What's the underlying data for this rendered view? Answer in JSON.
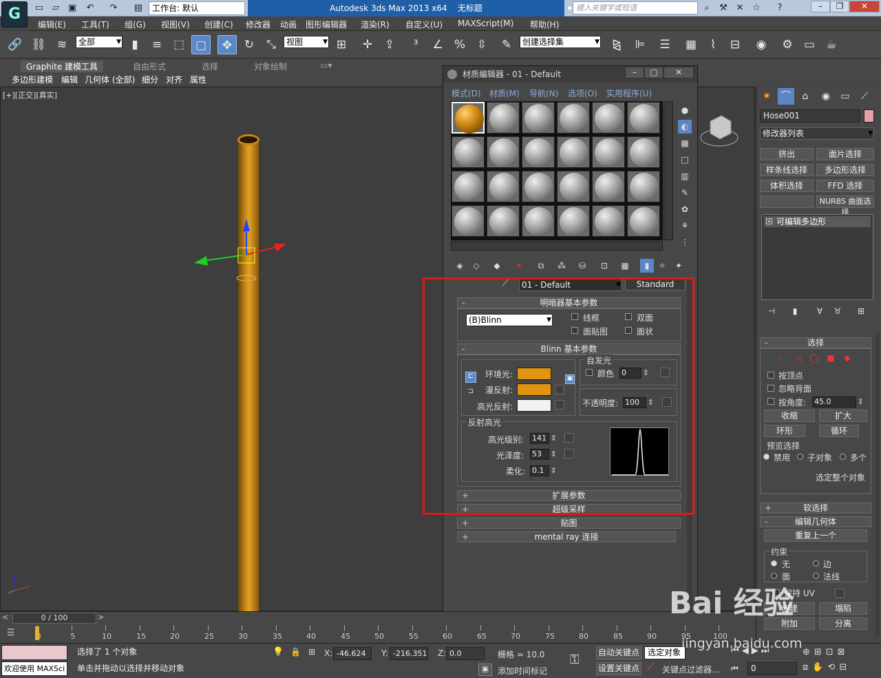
{
  "app": {
    "title": "Autodesk 3ds Max  2013 x64",
    "doc": "无标题",
    "workspace": "工作台: 默认",
    "search_placeholder": "键入关键字或短语",
    "logo": "G"
  },
  "menu": [
    "编辑(E)",
    "工具(T)",
    "组(G)",
    "视图(V)",
    "创建(C)",
    "修改器",
    "动画",
    "图形编辑器",
    "渲染(R)",
    "自定义(U)",
    "MAXScript(M)",
    "帮助(H)"
  ],
  "toolbar": {
    "filter": "全部",
    "refcoord": "视图",
    "selset": "创建选择集"
  },
  "ribbon": {
    "tabs": [
      "Graphite 建模工具",
      "自由形式",
      "选择",
      "对象绘制"
    ],
    "subtabs": [
      "多边形建模",
      "编辑",
      "几何体 (全部)",
      "细分",
      "对齐",
      "属性"
    ]
  },
  "viewport": {
    "label": "[+][正交][真实]"
  },
  "material_editor": {
    "title": "材质编辑器 - 01 - Default",
    "menu": [
      "模式(D)",
      "材质(M)",
      "导航(N)",
      "选项(O)",
      "实用程序(U)"
    ],
    "material_name": "01 - Default",
    "material_type": "Standard",
    "shader_rollout": {
      "title": "明暗器基本参数",
      "shader": "(B)Blinn",
      "options": [
        "线框",
        "双面",
        "面贴图",
        "面状"
      ]
    },
    "blinn_rollout": {
      "title": "Blinn 基本参数",
      "self_illum_group": "自发光",
      "self_illum_color_label": "颜色",
      "self_illum_value": "0",
      "ambient_label": "环境光:",
      "diffuse_label": "漫反射:",
      "specular_label": "高光反射:",
      "opacity_label": "不透明度:",
      "opacity_value": "100",
      "ambient_color": "#e0940f",
      "diffuse_color": "#e0940f",
      "specular_color": "#f2f2f2"
    },
    "highlights": {
      "title": "反射高光",
      "spec_level_label": "高光级别:",
      "spec_level": "141",
      "glossiness_label": "光泽度:",
      "glossiness": "53",
      "soften_label": "柔化:",
      "soften": "0.1"
    },
    "collapsed_rollouts": [
      "扩展参数",
      "超级采样",
      "贴图",
      "mental ray 连接"
    ]
  },
  "command_panel": {
    "object_name": "Hose001",
    "object_color": "#e8a0a8",
    "modifier_list": "修改器列表",
    "mod_buttons": [
      "挤出",
      "面片选择",
      "样条线选择",
      "多边形选择",
      "体积选择",
      "FFD 选择",
      "",
      "NURBS 曲面选择"
    ],
    "stack_item": "可编辑多边形",
    "selection": {
      "title": "选择",
      "by_vertex": "按顶点",
      "ignore_back": "忽略背面",
      "by_angle": "按角度:",
      "angle": "45.0",
      "shrink": "收缩",
      "grow": "扩大",
      "ring": "环形",
      "loop": "循环",
      "preview": "预览选择",
      "preview_opts": [
        "禁用",
        "子对象",
        "多个"
      ],
      "select_all": "选定整个对象"
    },
    "soft_selection": "软选择",
    "edit_geometry": "编辑几何体",
    "repeat_last": "重复上一个",
    "constraints": {
      "title": "约束",
      "opts": [
        "无",
        "边",
        "面",
        "法线"
      ]
    },
    "preserve_uv": "保持 UV",
    "create": "创建",
    "collapse": "塌陷",
    "attach": "附加",
    "detach": "分离"
  },
  "timeline": {
    "frame": "0 / 100",
    "ticks": [
      "0",
      "5",
      "10",
      "15",
      "20",
      "25",
      "30",
      "35",
      "40",
      "45",
      "50",
      "55",
      "60",
      "65",
      "70",
      "75",
      "80",
      "85",
      "90",
      "95",
      "100"
    ]
  },
  "status": {
    "welcome": "欢迎使用 MAXSci",
    "selected": "选择了 1 个对象",
    "hint": "单击并拖动以选择并移动对象",
    "x": "-46.624",
    "y": "-216.351",
    "z": "0.0",
    "grid": "栅格 = 10.0",
    "add_time_tag": "添加时间标记",
    "auto_key": "自动关键点",
    "selected_obj": "选定对象",
    "set_key": "设置关键点",
    "key_filter": "关键点过滤器...",
    "frame_field": "0"
  },
  "watermark": {
    "brand": "Bai  经验",
    "url": "jingyan.baidu.com"
  }
}
